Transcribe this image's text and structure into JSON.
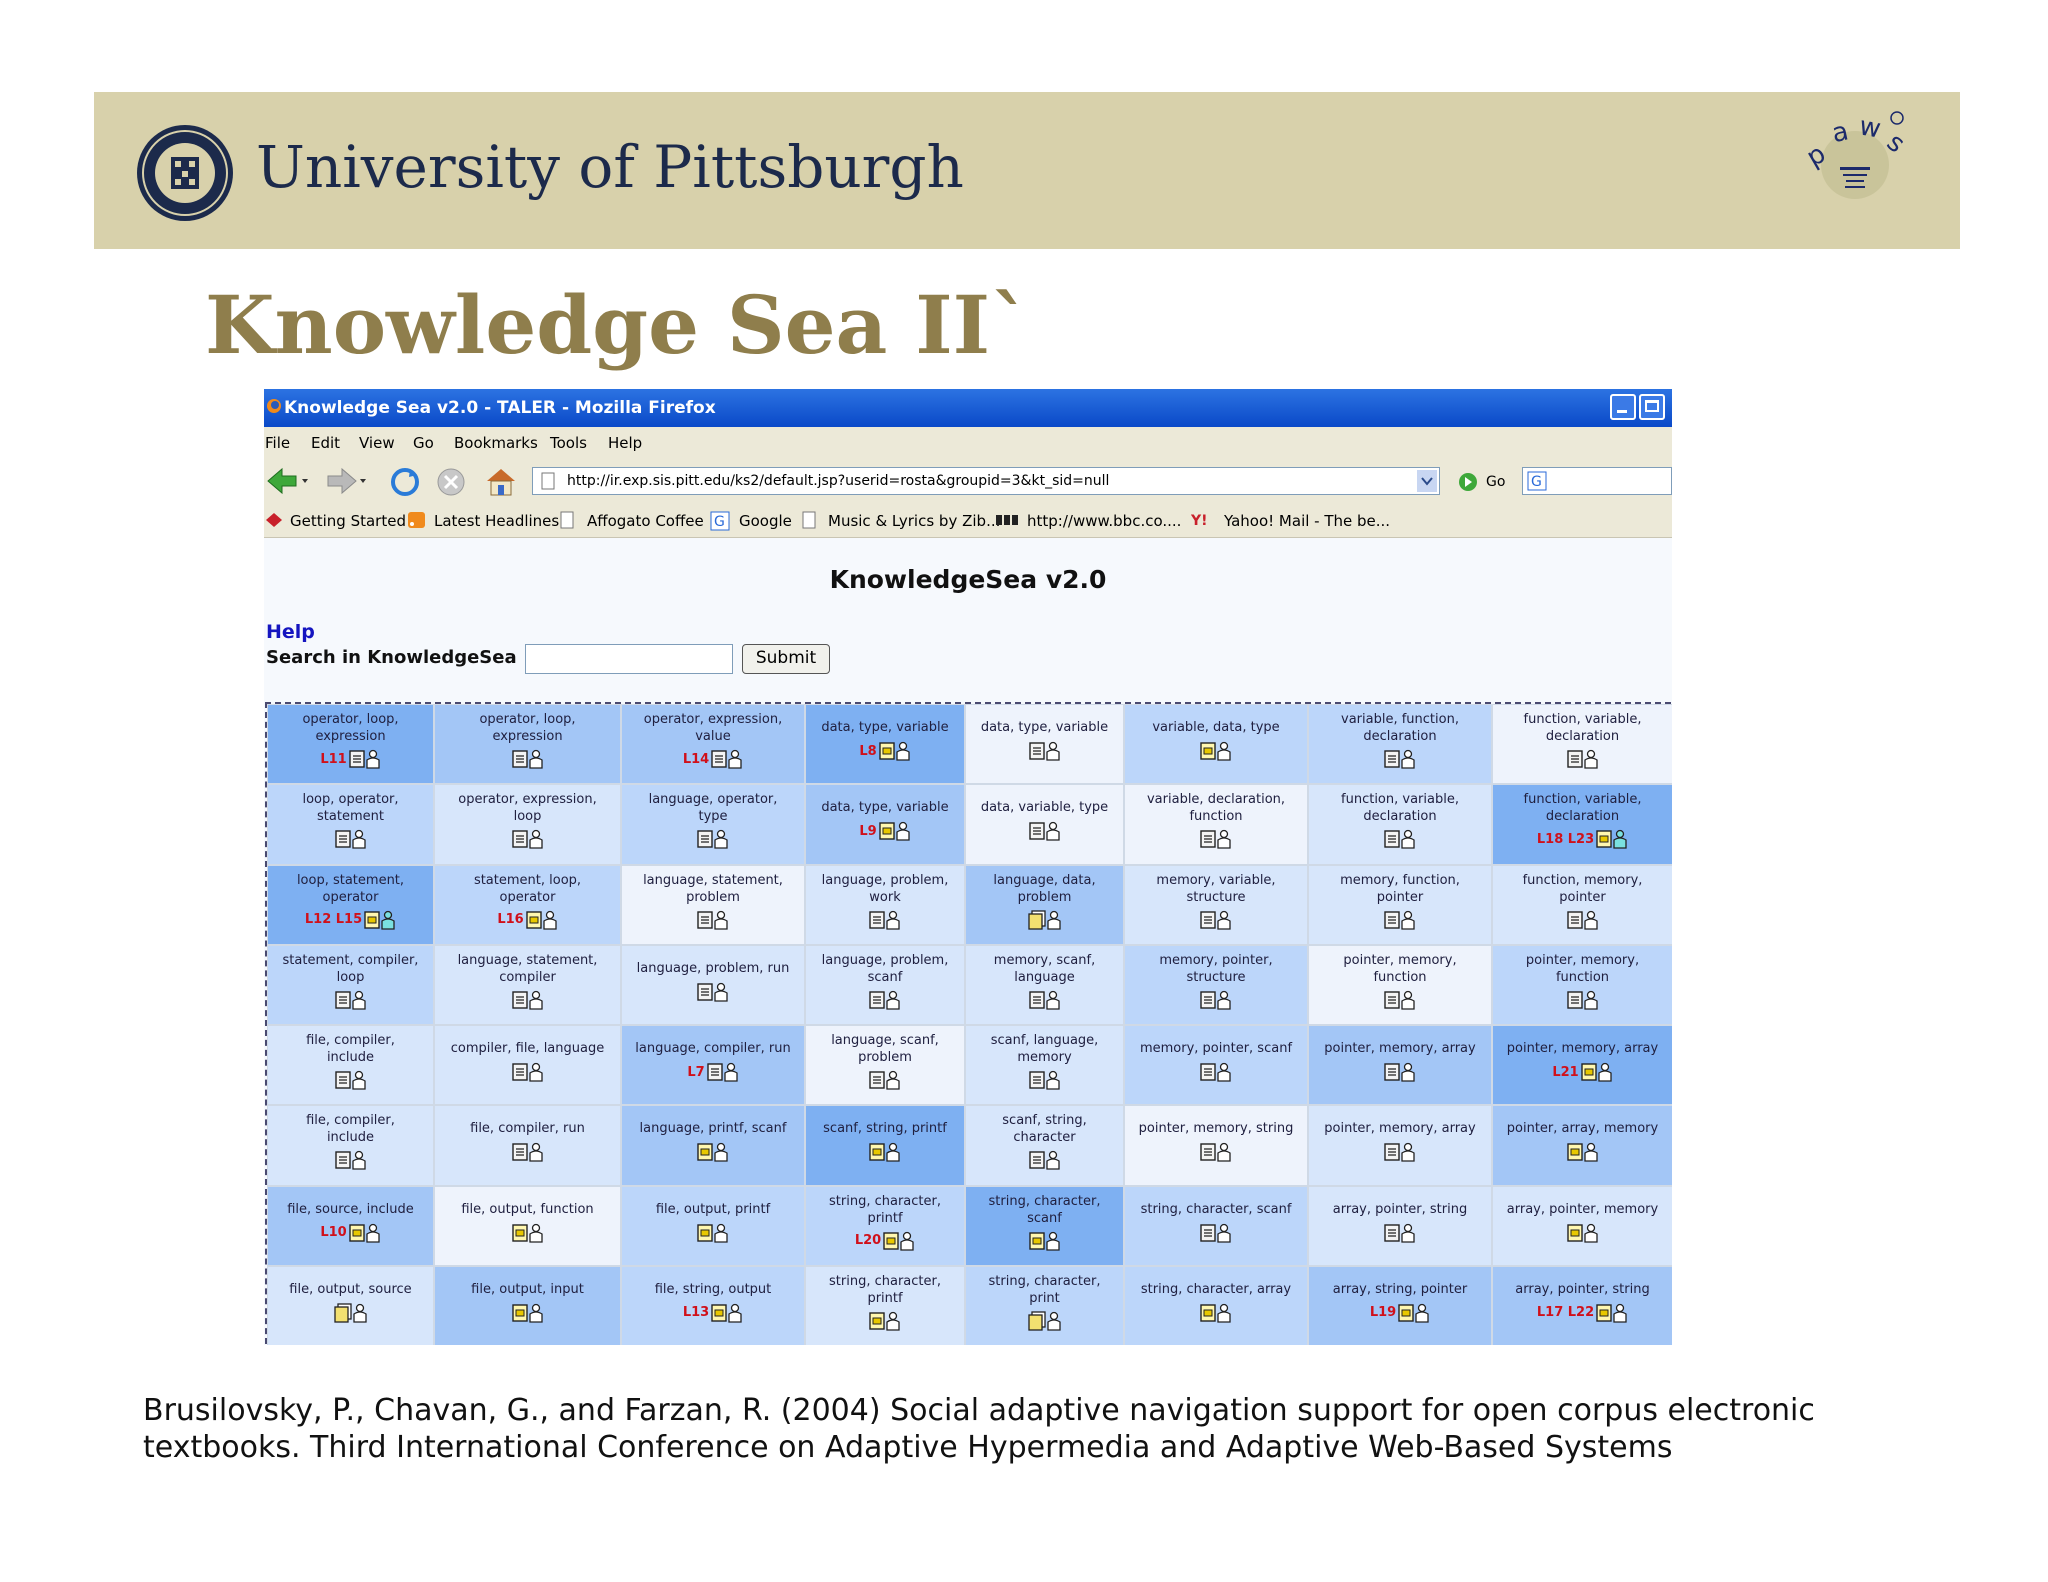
{
  "header": {
    "university": "University of Pittsburgh",
    "header_color": "#d8d1ab"
  },
  "slide": {
    "title": "Knowledge Sea II`",
    "title_color": "#8f7e4c",
    "citation_lines": [
      "Brusilovsky, P., Chavan, G., and Farzan, R. (2004) Social adaptive navigation support for open corpus electronic",
      "textbooks. Third International Conference on Adaptive Hypermedia and Adaptive Web-Based Systems"
    ]
  },
  "browser": {
    "window_title": "Knowledge Sea v2.0 - TALER - Mozilla Firefox",
    "menu": [
      "File",
      "Edit",
      "View",
      "Go",
      "Bookmarks",
      "Tools",
      "Help"
    ],
    "url": "http://ir.exp.sis.pitt.edu/ks2/default.jsp?userid=rosta&groupid=3&kt_sid=null",
    "go_label": "Go",
    "bookmarks": [
      "Getting Started",
      "Latest Headlines",
      "Affogato Coffee",
      "Google",
      "Music & Lyrics by Zib...",
      "http://www.bbc.co....",
      "Yahoo! Mail - The be..."
    ]
  },
  "page": {
    "heading": "KnowledgeSea v2.0",
    "help_link": "Help",
    "search_label": "Search in KnowledgeSea",
    "search_value": "",
    "submit_label": "Submit"
  },
  "grid": {
    "shade_colors": [
      "#eef3fc",
      "#d7e6fb",
      "#bcd6fa",
      "#a3c6f6",
      "#7eb0f2"
    ],
    "rows": [
      [
        {
          "topics": [
            "operator, loop,",
            "expression"
          ],
          "label": "L11",
          "shade": 4,
          "icon": "doc"
        },
        {
          "topics": [
            "operator, loop,",
            "expression"
          ],
          "label": "",
          "shade": 3,
          "icon": "doc"
        },
        {
          "topics": [
            "operator, expression,",
            "value"
          ],
          "label": "L14",
          "shade": 3,
          "icon": "doc"
        },
        {
          "topics": [
            "data, type, variable"
          ],
          "label": "L8",
          "shade": 4,
          "icon": "folder"
        },
        {
          "topics": [
            "data, type, variable"
          ],
          "label": "",
          "shade": 0,
          "icon": "doc"
        },
        {
          "topics": [
            "variable, data, type"
          ],
          "label": "",
          "shade": 2,
          "icon": "folder"
        },
        {
          "topics": [
            "variable, function,",
            "declaration"
          ],
          "label": "",
          "shade": 2,
          "icon": "doc"
        },
        {
          "topics": [
            "function, variable,",
            "declaration"
          ],
          "label": "",
          "shade": 0,
          "icon": "doc"
        }
      ],
      [
        {
          "topics": [
            "loop, operator,",
            "statement"
          ],
          "label": "",
          "shade": 2,
          "icon": "doc"
        },
        {
          "topics": [
            "operator, expression,",
            "loop"
          ],
          "label": "",
          "shade": 1,
          "icon": "doc"
        },
        {
          "topics": [
            "language, operator,",
            "type"
          ],
          "label": "",
          "shade": 2,
          "icon": "doc"
        },
        {
          "topics": [
            "data, type, variable"
          ],
          "label": "L9",
          "shade": 3,
          "icon": "folder"
        },
        {
          "topics": [
            "data, variable, type"
          ],
          "label": "",
          "shade": 0,
          "icon": "doc"
        },
        {
          "topics": [
            "variable, declaration,",
            "function"
          ],
          "label": "",
          "shade": 0,
          "icon": "doc"
        },
        {
          "topics": [
            "function, variable,",
            "declaration"
          ],
          "label": "",
          "shade": 1,
          "icon": "doc"
        },
        {
          "topics": [
            "function, variable,",
            "declaration"
          ],
          "label": "L18 L23",
          "shade": 4,
          "icon": "folder-person"
        }
      ],
      [
        {
          "topics": [
            "loop, statement,",
            "operator"
          ],
          "label": "L12 L15",
          "shade": 4,
          "icon": "folder-person"
        },
        {
          "topics": [
            "statement, loop,",
            "operator"
          ],
          "label": "L16",
          "shade": 2,
          "icon": "folder"
        },
        {
          "topics": [
            "language, statement,",
            "problem"
          ],
          "label": "",
          "shade": 0,
          "icon": "doc"
        },
        {
          "topics": [
            "language, problem,",
            "work"
          ],
          "label": "",
          "shade": 1,
          "icon": "doc"
        },
        {
          "topics": [
            "language, data,",
            "problem"
          ],
          "label": "",
          "shade": 3,
          "icon": "copy"
        },
        {
          "topics": [
            "memory, variable,",
            "structure"
          ],
          "label": "",
          "shade": 1,
          "icon": "doc"
        },
        {
          "topics": [
            "memory, function,",
            "pointer"
          ],
          "label": "",
          "shade": 1,
          "icon": "doc"
        },
        {
          "topics": [
            "function, memory,",
            "pointer"
          ],
          "label": "",
          "shade": 1,
          "icon": "doc"
        }
      ],
      [
        {
          "topics": [
            "statement, compiler,",
            "loop"
          ],
          "label": "",
          "shade": 2,
          "icon": "doc"
        },
        {
          "topics": [
            "language, statement,",
            "compiler"
          ],
          "label": "",
          "shade": 1,
          "icon": "doc"
        },
        {
          "topics": [
            "language, problem, run"
          ],
          "label": "",
          "shade": 1,
          "icon": "doc"
        },
        {
          "topics": [
            "language, problem,",
            "scanf"
          ],
          "label": "",
          "shade": 1,
          "icon": "doc"
        },
        {
          "topics": [
            "memory, scanf,",
            "language"
          ],
          "label": "",
          "shade": 1,
          "icon": "doc"
        },
        {
          "topics": [
            "memory, pointer,",
            "structure"
          ],
          "label": "",
          "shade": 2,
          "icon": "doc"
        },
        {
          "topics": [
            "pointer, memory,",
            "function"
          ],
          "label": "",
          "shade": 0,
          "icon": "doc"
        },
        {
          "topics": [
            "pointer, memory,",
            "function"
          ],
          "label": "",
          "shade": 2,
          "icon": "doc"
        }
      ],
      [
        {
          "topics": [
            "file, compiler,",
            "include"
          ],
          "label": "",
          "shade": 1,
          "icon": "doc"
        },
        {
          "topics": [
            "compiler, file, language"
          ],
          "label": "",
          "shade": 1,
          "icon": "doc"
        },
        {
          "topics": [
            "language, compiler, run"
          ],
          "label": "L7",
          "shade": 3,
          "icon": "doc"
        },
        {
          "topics": [
            "language, scanf,",
            "problem"
          ],
          "label": "",
          "shade": 0,
          "icon": "doc"
        },
        {
          "topics": [
            "scanf, language,",
            "memory"
          ],
          "label": "",
          "shade": 1,
          "icon": "doc"
        },
        {
          "topics": [
            "memory, pointer, scanf"
          ],
          "label": "",
          "shade": 2,
          "icon": "doc"
        },
        {
          "topics": [
            "pointer, memory, array"
          ],
          "label": "",
          "shade": 3,
          "icon": "doc"
        },
        {
          "topics": [
            "pointer, memory, array"
          ],
          "label": "L21",
          "shade": 4,
          "icon": "folder"
        }
      ],
      [
        {
          "topics": [
            "file, compiler,",
            "include"
          ],
          "label": "",
          "shade": 1,
          "icon": "doc"
        },
        {
          "topics": [
            "file, compiler, run"
          ],
          "label": "",
          "shade": 1,
          "icon": "doc"
        },
        {
          "topics": [
            "language, printf, scanf"
          ],
          "label": "",
          "shade": 3,
          "icon": "folder"
        },
        {
          "topics": [
            "scanf, string, printf"
          ],
          "label": "",
          "shade": 4,
          "icon": "folder"
        },
        {
          "topics": [
            "scanf, string,",
            "character"
          ],
          "label": "",
          "shade": 1,
          "icon": "doc"
        },
        {
          "topics": [
            "pointer, memory, string"
          ],
          "label": "",
          "shade": 0,
          "icon": "doc"
        },
        {
          "topics": [
            "pointer, memory, array"
          ],
          "label": "",
          "shade": 1,
          "icon": "doc"
        },
        {
          "topics": [
            "pointer, array, memory"
          ],
          "label": "",
          "shade": 3,
          "icon": "folder"
        }
      ],
      [
        {
          "topics": [
            "file, source, include"
          ],
          "label": "L10",
          "shade": 3,
          "icon": "folder"
        },
        {
          "topics": [
            "file, output, function"
          ],
          "label": "",
          "shade": 0,
          "icon": "folder"
        },
        {
          "topics": [
            "file, output, printf"
          ],
          "label": "",
          "shade": 2,
          "icon": "folder"
        },
        {
          "topics": [
            "string, character,",
            "printf"
          ],
          "label": "L20",
          "shade": 2,
          "icon": "folder"
        },
        {
          "topics": [
            "string, character,",
            "scanf"
          ],
          "label": "",
          "shade": 4,
          "icon": "folder"
        },
        {
          "topics": [
            "string, character, scanf"
          ],
          "label": "",
          "shade": 2,
          "icon": "doc"
        },
        {
          "topics": [
            "array, pointer, string"
          ],
          "label": "",
          "shade": 1,
          "icon": "doc"
        },
        {
          "topics": [
            "array, pointer, memory"
          ],
          "label": "",
          "shade": 1,
          "icon": "folder"
        }
      ],
      [
        {
          "topics": [
            "file, output, source"
          ],
          "label": "",
          "shade": 1,
          "icon": "copy"
        },
        {
          "topics": [
            "file, output, input"
          ],
          "label": "",
          "shade": 3,
          "icon": "folder"
        },
        {
          "topics": [
            "file, string, output"
          ],
          "label": "L13",
          "shade": 2,
          "icon": "folder"
        },
        {
          "topics": [
            "string, character,",
            "printf"
          ],
          "label": "",
          "shade": 1,
          "icon": "folder"
        },
        {
          "topics": [
            "string, character,",
            "print"
          ],
          "label": "",
          "shade": 2,
          "icon": "copy"
        },
        {
          "topics": [
            "string, character, array"
          ],
          "label": "",
          "shade": 2,
          "icon": "folder"
        },
        {
          "topics": [
            "array, string, pointer"
          ],
          "label": "L19",
          "shade": 3,
          "icon": "folder"
        },
        {
          "topics": [
            "array, pointer, string"
          ],
          "label": "L17 L22",
          "shade": 3,
          "icon": "folder"
        }
      ]
    ]
  }
}
